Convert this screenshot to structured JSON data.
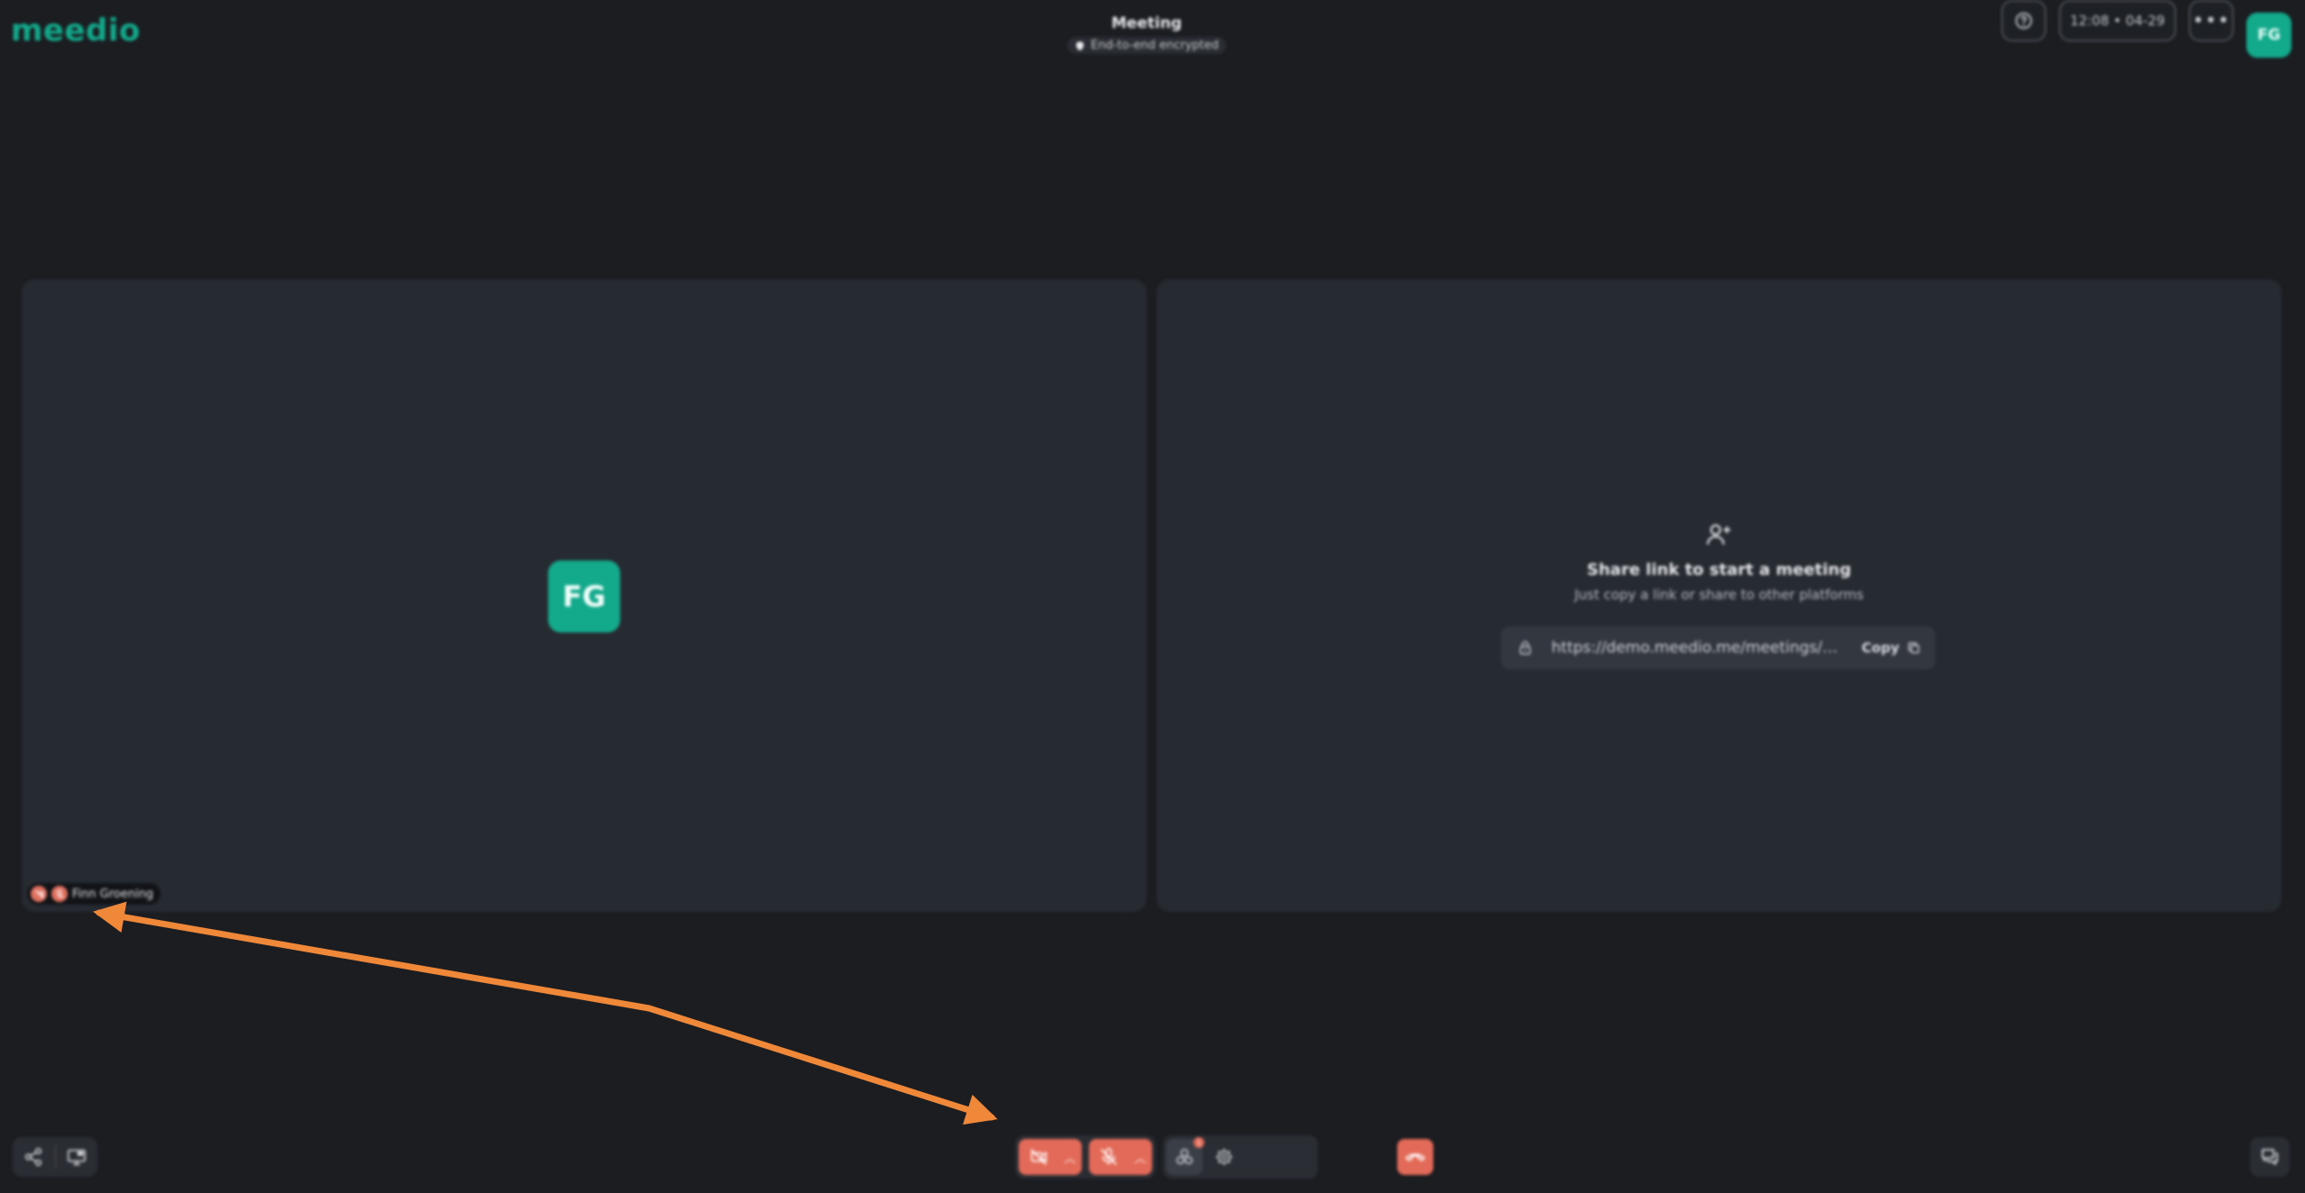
{
  "app": {
    "logo_text": "meedio",
    "brand_color": "#13a98b",
    "danger_color": "#e36a58"
  },
  "header": {
    "title": "Meeting",
    "encryption_badge": "End-to-end encrypted",
    "help_icon": "help-icon",
    "time_display": "12:08 • 04-29",
    "more_icon": "more-horizontal-icon",
    "user_initials": "FG"
  },
  "participant_tile": {
    "initials": "FG",
    "name": "Finn Groening",
    "camera_status_icon": "camera-off-icon",
    "mic_status_icon": "mic-off-icon"
  },
  "share_tile": {
    "icon": "add-user-icon",
    "title": "Share link to start a meeting",
    "subtitle": "Just copy a link or share to other platforms",
    "link": "https://demo.meedio.me/meetings/al...",
    "copy_label": "Copy"
  },
  "bottom_bar": {
    "share_icon": "share-icon",
    "screen_share_icon": "screen-share-icon",
    "camera_icon": "camera-off-icon",
    "mic_icon": "mic-off-icon",
    "apps_icon": "apps-icon",
    "apps_badge": "1",
    "settings_icon": "gear-icon",
    "leave_icon": "hang-up-icon",
    "chat_icon": "chat-icon"
  },
  "annotation": {
    "color": "#f0883a"
  }
}
